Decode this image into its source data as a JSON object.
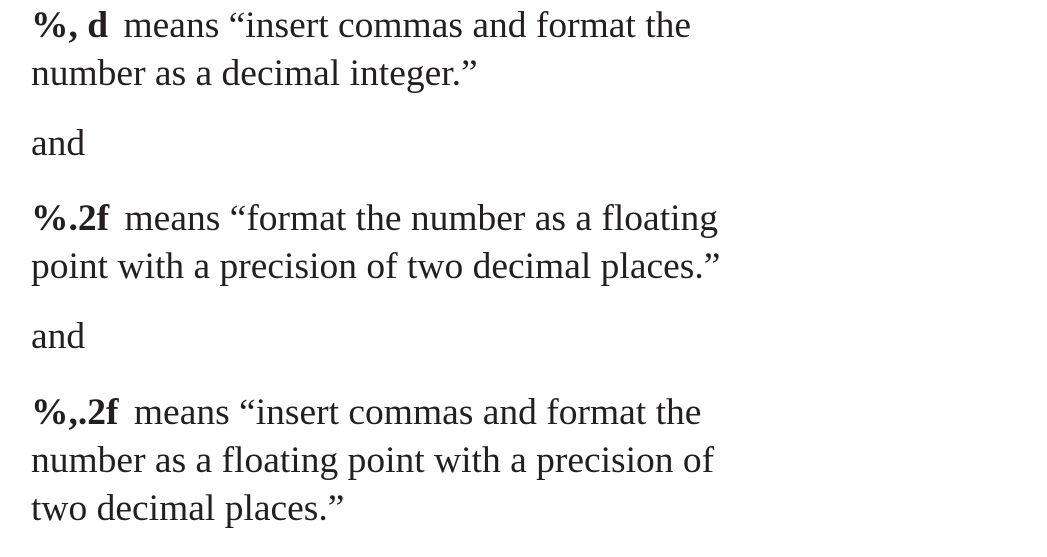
{
  "definitions": [
    {
      "code": "%, d",
      "line1": "means “insert commas and format the",
      "line2": "number as a decimal integer.”"
    },
    {
      "code": "%.2f",
      "line1": "means “format the number as a floating",
      "line2": "point with a precision of two decimal places.”"
    },
    {
      "code": "%,.2f",
      "line1": "means “insert commas and format the",
      "line2": "number as a floating point with a precision of",
      "line3": "two decimal places.”"
    }
  ],
  "connectors": [
    "and",
    "and"
  ]
}
